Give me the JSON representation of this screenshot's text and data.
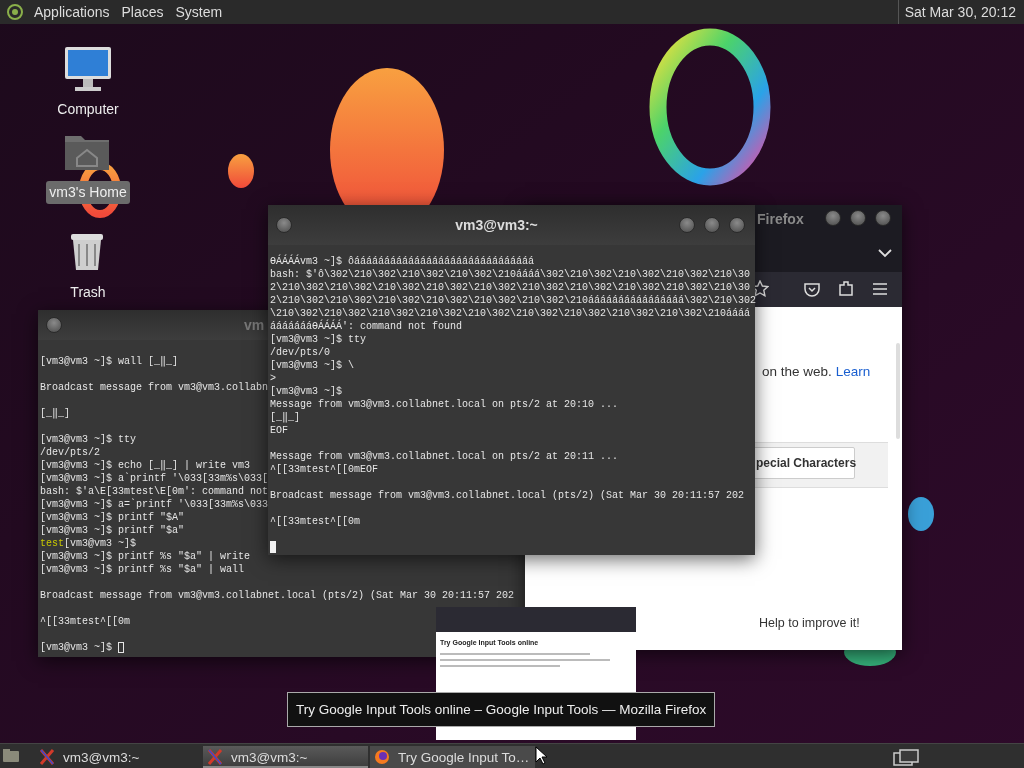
{
  "top_panel": {
    "menus": [
      "Applications",
      "Places",
      "System"
    ],
    "clock": "Sat Mar 30, 20:12"
  },
  "desktop_icons": [
    {
      "kind": "computer",
      "label": "Computer",
      "selected": false
    },
    {
      "kind": "home",
      "label": "vm3's Home",
      "selected": true
    },
    {
      "kind": "trash",
      "label": "Trash",
      "selected": false
    }
  ],
  "terminal_back": {
    "title": "vm",
    "focused": false,
    "blocks": [
      [
        "[vm3@vm3 ~]$ wall [_‖_]"
      ],
      [
        "Broadcast message from vm3@vm3.collabn"
      ],
      [
        "[_‖_]"
      ],
      [
        "[vm3@vm3 ~]$ tty",
        "/dev/pts/2",
        "[vm3@vm3 ~]$ echo [_‖_] | write vm3",
        "[vm3@vm3 ~]$ a`printf '\\033[33m%s\\033[",
        "bash: $'a\\E[33mtest\\E[0m': command not",
        "[vm3@vm3 ~]$ a=`printf '\\033[33m%s\\033",
        "[vm3@vm3 ~]$ printf \"$A\"",
        "[vm3@vm3 ~]$ printf \"$a\"",
        [
          {
            "text": "test",
            "color": "#c8c800"
          },
          {
            "text": "[vm3@vm3 ~]$"
          }
        ],
        "[vm3@vm3 ~]$ printf %s \"$a\" | write",
        "[vm3@vm3 ~]$ printf %s \"$a\" | wall"
      ],
      [
        "Broadcast message from vm3@vm3.collabnet.local (pts/2) (Sat Mar 30 20:11:57 202"
      ],
      [
        "^[[33mtest^[[0m"
      ],
      [
        "[vm3@vm3 ~]$ "
      ]
    ]
  },
  "browser": {
    "title": "Firefox",
    "text": "on the web.",
    "link": "Learn",
    "button": "pecial Characters",
    "footer": "Help to improve it!"
  },
  "terminal_front": {
    "title": "vm3@vm3:~",
    "focused": true,
    "blocks": [
      [
        "ӨÁÁÁÁvm3 ~]$ ôáááááááááááááááááááááááááááááá",
        "bash: $'ô\\302\\210\\302\\210\\302\\210\\302\\210áááá\\302\\210\\302\\210\\302\\210\\302\\210\\30",
        "2\\210\\302\\210\\302\\210\\302\\210\\302\\210\\302\\210\\302\\210\\302\\210\\302\\210\\302\\210\\30",
        "2\\210\\302\\210\\302\\210\\302\\210\\302\\210\\302\\210\\302\\210áááááááááááááááá\\302\\210\\302",
        "\\210\\302\\210\\302\\210\\302\\210\\302\\210\\302\\210\\302\\210\\302\\210\\302\\210\\302\\210áááá",
        "áááááááӨÁÁÁÁ': command not found",
        "[vm3@vm3 ~]$ tty",
        "/dev/pts/0",
        "[vm3@vm3 ~]$ \\",
        ">",
        "[vm3@vm3 ~]$",
        "Message from vm3@vm3.collabnet.local on pts/2 at 20:10 ...",
        "[_‖_]",
        "EOF"
      ],
      [
        "Message from vm3@vm3.collabnet.local on pts/2 at 20:11 ...",
        "^[[33mtest^[[0mEOF"
      ],
      [
        "Broadcast message from vm3@vm3.collabnet.local (pts/2) (Sat Mar 30 20:11:57 202"
      ],
      [
        "^[[33mtest^[[0m"
      ]
    ]
  },
  "preview": {
    "heading": "Try Google Input Tools online"
  },
  "tooltip": "Try Google Input Tools online – Google Input Tools — Mozilla Firefox",
  "taskbar": {
    "items": [
      {
        "kind": "terminal",
        "label": "vm3@vm3:~",
        "selected": false,
        "hovered": false
      },
      {
        "kind": "terminal",
        "label": "vm3@vm3:~",
        "selected": true,
        "hovered": false
      },
      {
        "kind": "firefox",
        "label": "Try Google Input To…",
        "selected": false,
        "hovered": true
      }
    ]
  }
}
